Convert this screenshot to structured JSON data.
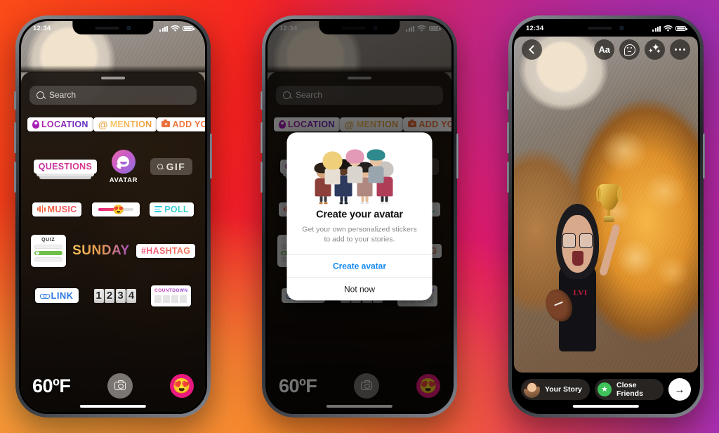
{
  "phones": {
    "status_time": "12:34",
    "phone1": {
      "name": "sticker-tray-screen",
      "search_placeholder": "Search",
      "stickers": {
        "row1": [
          {
            "id": "location",
            "label": "LOCATION",
            "icon": "location-pin-icon"
          },
          {
            "id": "mention",
            "label": "MENTION",
            "icon": "at-sign-icon"
          },
          {
            "id": "add-yours",
            "label": "ADD YOURS",
            "icon": "camera-icon"
          }
        ],
        "row2": [
          {
            "id": "questions",
            "label": "QUESTIONS"
          },
          {
            "id": "avatar",
            "label": "AVATAR",
            "icon": "avatar-face-icon"
          },
          {
            "id": "gif",
            "label": "GIF",
            "icon": "search-icon"
          }
        ],
        "row3": [
          {
            "id": "music",
            "label": "MUSIC",
            "icon": "music-wave-icon"
          },
          {
            "id": "emoji-slider",
            "label": "",
            "emoji": "😍"
          },
          {
            "id": "poll",
            "label": "POLL",
            "icon": "poll-bars-icon"
          }
        ],
        "row4": [
          {
            "id": "quiz",
            "label": "QUIZ"
          },
          {
            "id": "sunday",
            "label": "SUNDAY"
          },
          {
            "id": "hashtag",
            "label": "#HASHTAG"
          }
        ],
        "row5": [
          {
            "id": "link",
            "label": "LINK",
            "icon": "chain-link-icon"
          },
          {
            "id": "countdown-digits",
            "digits": [
              "1",
              "2",
              "3",
              "4"
            ]
          },
          {
            "id": "countdown",
            "label": "COUNTDOWN"
          }
        ]
      },
      "footer": {
        "temperature": "60ºF",
        "shutter": "camera-icon",
        "emoji": "😍"
      }
    },
    "phone2": {
      "name": "create-avatar-modal-screen",
      "search_placeholder": "Search",
      "modal": {
        "title": "Create your avatar",
        "subtitle": "Get your own personalized stickers to add to your stories.",
        "primary_action": "Create avatar",
        "secondary_action": "Not now"
      },
      "footer": {
        "temperature": "60ºF"
      }
    },
    "phone3": {
      "name": "story-editor-screen",
      "top_controls": [
        {
          "id": "back",
          "icon": "chevron-left-icon"
        },
        {
          "id": "text",
          "icon": "text-Aa-icon",
          "label": "Aa"
        },
        {
          "id": "sticker",
          "icon": "sticker-smiley-icon"
        },
        {
          "id": "effects",
          "icon": "sparkles-icon"
        },
        {
          "id": "more",
          "icon": "ellipsis-icon"
        }
      ],
      "bottom": {
        "your_story": "Your Story",
        "close_friends": "Close Friends",
        "send": "→"
      }
    }
  },
  "colors": {
    "brand_purple": "#A12BBE",
    "brand_pink": "#EC1860",
    "brand_red": "#F42020",
    "brand_orange": "#FB4C18",
    "brand_amber": "#F7A33A",
    "link_blue": "#0F87F0",
    "close_friends_green": "#3EC35B",
    "emoji_button_pink": "#E8197E"
  }
}
